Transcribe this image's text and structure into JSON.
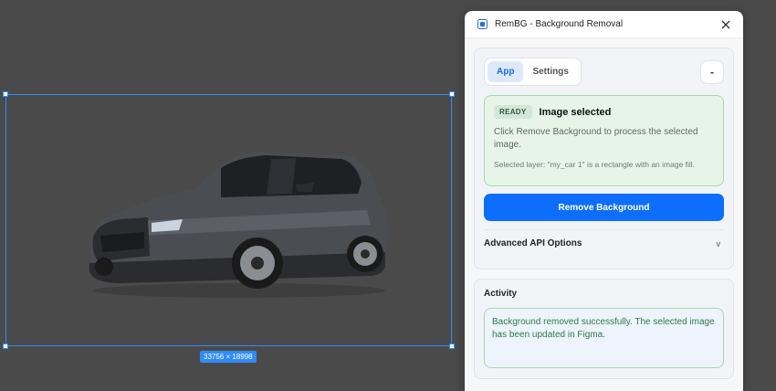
{
  "canvas": {
    "dimension_label": "33756 × 18998"
  },
  "panel": {
    "title": "RemBG - Background Removal",
    "tabs": [
      {
        "label": "App",
        "active": true
      },
      {
        "label": "Settings",
        "active": false
      }
    ],
    "collapse_label": "-",
    "status": {
      "badge": "READY",
      "title": "Image selected",
      "description": "Click Remove Background to process the selected image.",
      "selected_layer": "Selected layer: \"my_car 1\" is a rectangle with an image fill."
    },
    "remove_button": "Remove Background",
    "advanced_label": "Advanced API Options",
    "advanced_chevron": "v",
    "activity": {
      "title": "Activity",
      "log": "Background removed successfully. The selected image has been updated in Figma."
    }
  },
  "colors": {
    "accent": "#0d6efd",
    "selection": "#2f8cff",
    "status_bg": "#e6f5e8",
    "log_text": "#2f7a46"
  }
}
